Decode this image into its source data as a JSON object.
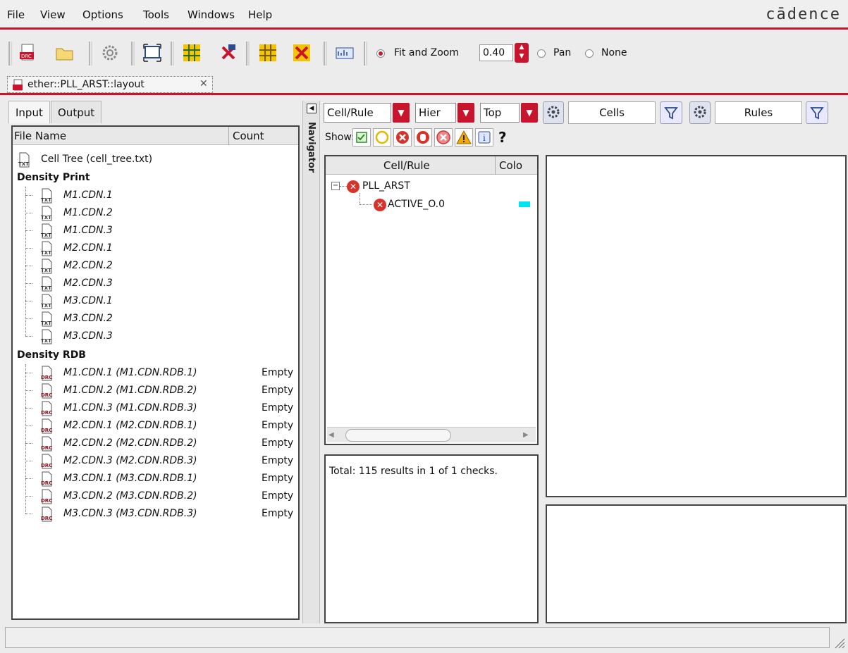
{
  "menu": [
    "File",
    "View",
    "Options",
    "Tools",
    "Windows",
    "Help"
  ],
  "brand": "cādence",
  "toolbar": {
    "fit_and_zoom_label": "Fit and Zoom",
    "zoom_value": "0.40",
    "pan_label": "Pan",
    "none_label": "None"
  },
  "doc_tab": {
    "title": "ether::PLL_ARST::layout",
    "close": "✕"
  },
  "left_tabs": [
    "Input",
    "Output"
  ],
  "file_panel": {
    "headers": [
      "File Name",
      "Count"
    ],
    "cell_tree": "Cell Tree (cell_tree.txt)",
    "density_print_heading": "Density Print",
    "density_print_items": [
      "M1.CDN.1",
      "M1.CDN.2",
      "M1.CDN.3",
      "M2.CDN.1",
      "M2.CDN.2",
      "M2.CDN.3",
      "M3.CDN.1",
      "M3.CDN.2",
      "M3.CDN.3"
    ],
    "density_rdb_heading": "Density RDB",
    "density_rdb_items": [
      {
        "name": "M1.CDN.1 (M1.CDN.RDB.1)",
        "count": "Empty"
      },
      {
        "name": "M1.CDN.2 (M1.CDN.RDB.2)",
        "count": "Empty"
      },
      {
        "name": "M1.CDN.3 (M1.CDN.RDB.3)",
        "count": "Empty"
      },
      {
        "name": "M2.CDN.1 (M2.CDN.RDB.1)",
        "count": "Empty"
      },
      {
        "name": "M2.CDN.2 (M2.CDN.RDB.2)",
        "count": "Empty"
      },
      {
        "name": "M2.CDN.3 (M2.CDN.RDB.3)",
        "count": "Empty"
      },
      {
        "name": "M3.CDN.1 (M3.CDN.RDB.1)",
        "count": "Empty"
      },
      {
        "name": "M3.CDN.2 (M3.CDN.RDB.2)",
        "count": "Empty"
      },
      {
        "name": "M3.CDN.3 (M3.CDN.RDB.3)",
        "count": "Empty"
      }
    ]
  },
  "navigator_label": "Navigator",
  "controls": {
    "view_mode": "Cell/Rule",
    "hier": "Hier",
    "top": "Top",
    "cells_search": "Cells",
    "rules_search": "Rules",
    "show_label": "Show:"
  },
  "cell_panel": {
    "headers": [
      "Cell/Rule",
      "Colo"
    ],
    "tree": [
      {
        "label": "PLL_ARST",
        "color": ""
      },
      {
        "label": "ACTIVE_O.0",
        "color": "#00e5ee"
      }
    ]
  },
  "summary": "Total: 115 results in 1 of 1 checks.",
  "colors": {
    "accent": "#c8142c",
    "error_icon": "#d7332a",
    "rule_swatch": "#00e5ee"
  }
}
